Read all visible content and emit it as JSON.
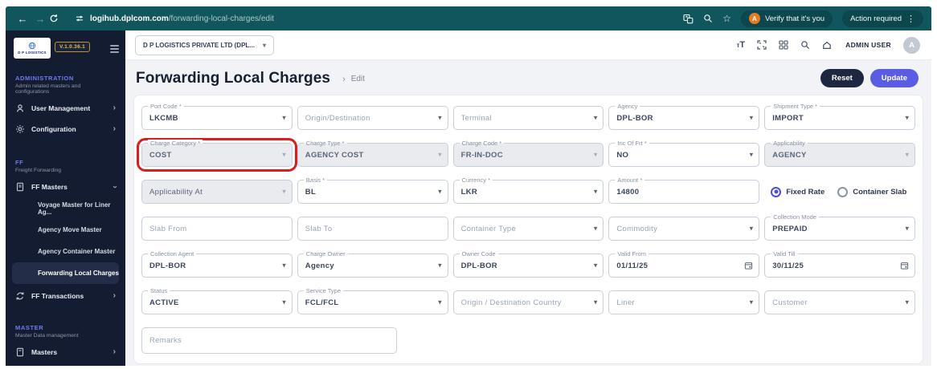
{
  "colors": {
    "chrome_teal": "#10565c",
    "chrome_pill": "#0b474d",
    "sidebar_bg": "#131c30",
    "section_purple": "#6f7bf2",
    "accent_purple": "#5a5ce4",
    "reset_navy": "#1d2740",
    "highlight_red": "#dc1d1d",
    "disabled_field_bg": "#e9ebef"
  },
  "icons": {
    "back": "←",
    "forward": "→",
    "star": "☆",
    "overflow_dots": "⋮",
    "caret": "▾",
    "chevron_right": "›",
    "avatar_letter": "A"
  },
  "browser": {
    "url_host": "logihub.dplcom.com",
    "url_path": "/forwarding-local-charges/edit",
    "verify_label": "Verify that it's you",
    "verify_avatar": "A",
    "action_label": "Action required"
  },
  "sidebar": {
    "logo_text": "D P LOGISTICS",
    "version": "V.1.0.36.1",
    "sections": [
      {
        "title": "ADMINISTRATION",
        "subtitle": "Admin related masters and configurations"
      },
      {
        "title": "FF",
        "subtitle": "Freight Forwarding"
      },
      {
        "title": "MASTER",
        "subtitle": "Master Data management"
      }
    ],
    "items": {
      "user_management": "User Management",
      "configuration": "Configuration",
      "ff_masters": "FF Masters",
      "voyage_master": "Voyage Master for Liner Ag...",
      "agency_move_master": "Agency Move Master",
      "agency_container_master": "Agency Container Master",
      "forwarding_local_charges": "Forwarding Local Charges",
      "ff_transactions": "FF Transactions",
      "masters": "Masters"
    }
  },
  "appbar": {
    "company": "D P LOGISTICS PRIVATE LTD  (DPL...",
    "user_name": "ADMIN USER",
    "avatar_letter": "A"
  },
  "page": {
    "title": "Forwarding Local Charges",
    "breadcrumb_sep": "›",
    "breadcrumb": "Edit",
    "reset_label": "Reset",
    "update_label": "Update"
  },
  "form": {
    "rows": [
      [
        {
          "label": "Port Code *",
          "value": "LKCMB"
        },
        {
          "placeholder": "Origin/Destination"
        },
        {
          "placeholder": "Terminal"
        },
        {
          "label": "Agency",
          "value": "DPL-BOR"
        },
        {
          "label": "Shipment Type *",
          "value": "IMPORT"
        }
      ],
      [
        {
          "label": "Charge Category *",
          "value": "COST",
          "disabled": true,
          "highlighted": true
        },
        {
          "label": "Charge Type *",
          "value": "AGENCY COST",
          "disabled": true
        },
        {
          "label": "Charge Code *",
          "value": "FR-IN-DOC",
          "disabled": true
        },
        {
          "label": "Inc Of Frt *",
          "value": "NO"
        },
        {
          "label": "Applicability",
          "value": "AGENCY",
          "disabled": true
        }
      ],
      [
        {
          "placeholder": "Applicability At",
          "disabled": true
        },
        {
          "label": "Basis *",
          "value": "BL"
        },
        {
          "label": "Currency *",
          "value": "LKR"
        },
        {
          "label": "Amount *",
          "value": "14800"
        }
      ],
      [
        {
          "placeholder": "Slab From"
        },
        {
          "placeholder": "Slab To"
        },
        {
          "placeholder": "Container Type"
        },
        {
          "placeholder": "Commodity"
        },
        {
          "label": "Collection Mode",
          "value": "PREPAID"
        }
      ],
      [
        {
          "label": "Collection Agent",
          "value": "DPL-BOR"
        },
        {
          "label": "Charge Owner",
          "value": "Agency"
        },
        {
          "label": "Owner Code",
          "value": "DPL-BOR"
        },
        {
          "label": "Valid From",
          "value": "01/11/25",
          "calendar": true
        },
        {
          "label": "Valid Till",
          "value": "30/11/25",
          "calendar": true
        }
      ],
      [
        {
          "label": "Status",
          "value": "ACTIVE"
        },
        {
          "label": "Service Type",
          "value": "FCL/FCL"
        },
        {
          "placeholder": "Origin / Destination Country"
        },
        {
          "placeholder": "Liner"
        },
        {
          "placeholder": "Customer"
        }
      ]
    ],
    "rate_type": {
      "fixed": "Fixed Rate",
      "slab": "Container Slab",
      "selected": "Fixed Rate"
    },
    "remarks_placeholder": "Remarks"
  }
}
